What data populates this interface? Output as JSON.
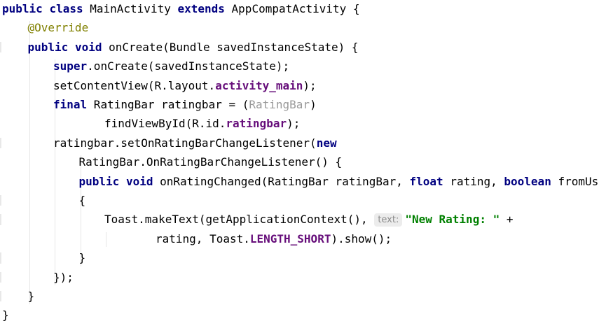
{
  "code_lines": [
    {
      "indent": 0,
      "tokens": [
        {
          "t": "public",
          "c": "kw"
        },
        {
          "t": " "
        },
        {
          "t": "class",
          "c": "kw"
        },
        {
          "t": " MainActivity "
        },
        {
          "t": "extends",
          "c": "kw"
        },
        {
          "t": " AppCompatActivity {"
        }
      ]
    },
    {
      "indent": 1,
      "tokens": [
        {
          "t": "@Override",
          "c": "ann"
        }
      ]
    },
    {
      "indent": 1,
      "tokens": [
        {
          "t": "public",
          "c": "kw"
        },
        {
          "t": " "
        },
        {
          "t": "void",
          "c": "kw"
        },
        {
          "t": " onCreate(Bundle savedInstanceState) {"
        }
      ]
    },
    {
      "indent": 2,
      "tokens": [
        {
          "t": "super",
          "c": "kw"
        },
        {
          "t": ".onCreate(savedInstanceState);"
        }
      ]
    },
    {
      "indent": 2,
      "tokens": [
        {
          "t": "setContentView(R.layout."
        },
        {
          "t": "activity_main",
          "c": "field"
        },
        {
          "t": ");"
        }
      ]
    },
    {
      "indent": 2,
      "tokens": [
        {
          "t": "final",
          "c": "kw"
        },
        {
          "t": " RatingBar ratingbar = ("
        },
        {
          "t": "RatingBar",
          "c": "cast"
        },
        {
          "t": ")"
        }
      ]
    },
    {
      "indent": 4,
      "tokens": [
        {
          "t": "findViewById(R.id."
        },
        {
          "t": "ratingbar",
          "c": "field"
        },
        {
          "t": ");"
        }
      ]
    },
    {
      "indent": 2,
      "tokens": [
        {
          "t": "ratingbar.setOnRatingBarChangeListener("
        },
        {
          "t": "new",
          "c": "kw"
        }
      ]
    },
    {
      "indent": 3,
      "tokens": [
        {
          "t": "RatingBar.OnRatingBarChangeListener() {"
        }
      ]
    },
    {
      "indent": 3,
      "tokens": [
        {
          "t": "public",
          "c": "kw"
        },
        {
          "t": " "
        },
        {
          "t": "void",
          "c": "kw"
        },
        {
          "t": " onRatingChanged(RatingBar ratingBar, "
        },
        {
          "t": "float",
          "c": "kw"
        },
        {
          "t": " rating, "
        },
        {
          "t": "boolean",
          "c": "kw"
        },
        {
          "t": " fromUser)"
        }
      ]
    },
    {
      "indent": 3,
      "tokens": [
        {
          "t": "{"
        }
      ]
    },
    {
      "indent": 4,
      "tokens": [
        {
          "t": "Toast.makeText(getApplicationContext(), "
        },
        {
          "t": "text:",
          "c": "hint"
        },
        {
          "t": "\"New Rating: \"",
          "c": "str"
        },
        {
          "t": " +"
        }
      ]
    },
    {
      "indent": 6,
      "tokens": [
        {
          "t": "rating, Toast."
        },
        {
          "t": "LENGTH_SHORT",
          "c": "field"
        },
        {
          "t": ").show();"
        }
      ]
    },
    {
      "indent": 3,
      "tokens": [
        {
          "t": "}"
        }
      ]
    },
    {
      "indent": 2,
      "tokens": [
        {
          "t": "});"
        }
      ]
    },
    {
      "indent": 1,
      "tokens": [
        {
          "t": "}"
        }
      ]
    },
    {
      "indent": 0,
      "tokens": [
        {
          "t": "}"
        }
      ]
    }
  ],
  "colors": {
    "keyword": "#000080",
    "annotation": "#808000",
    "field": "#660e7a",
    "cast_hint": "#999999",
    "string": "#008000",
    "inlay_hint_bg": "#ececec"
  }
}
